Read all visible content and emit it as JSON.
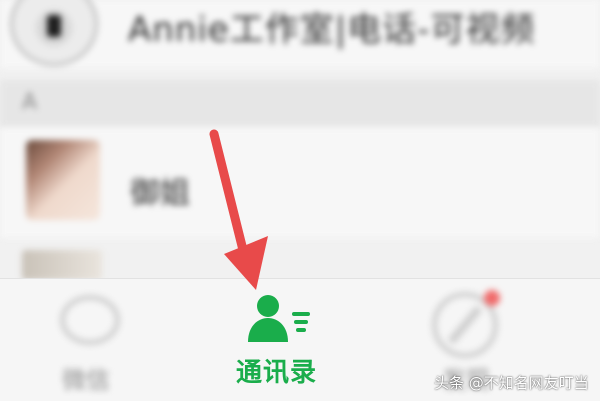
{
  "top_contact": {
    "name": "Annie工作室|电话-可视频"
  },
  "section": {
    "letter": "A"
  },
  "contact": {
    "name": "御姐"
  },
  "tabs": {
    "chats_label": "微信",
    "contacts_label": "通讯录",
    "discover_label": "发现"
  },
  "colors": {
    "accent_green": "#1aad4b",
    "arrow_red": "#e84a4a",
    "badge_red": "#f06a6a"
  },
  "icons": {
    "contacts": "contacts-person-list-icon",
    "chats": "chat-bubble-icon",
    "discover": "compass-icon"
  },
  "watermark": {
    "text": "头条 @不知名网友叮当"
  }
}
